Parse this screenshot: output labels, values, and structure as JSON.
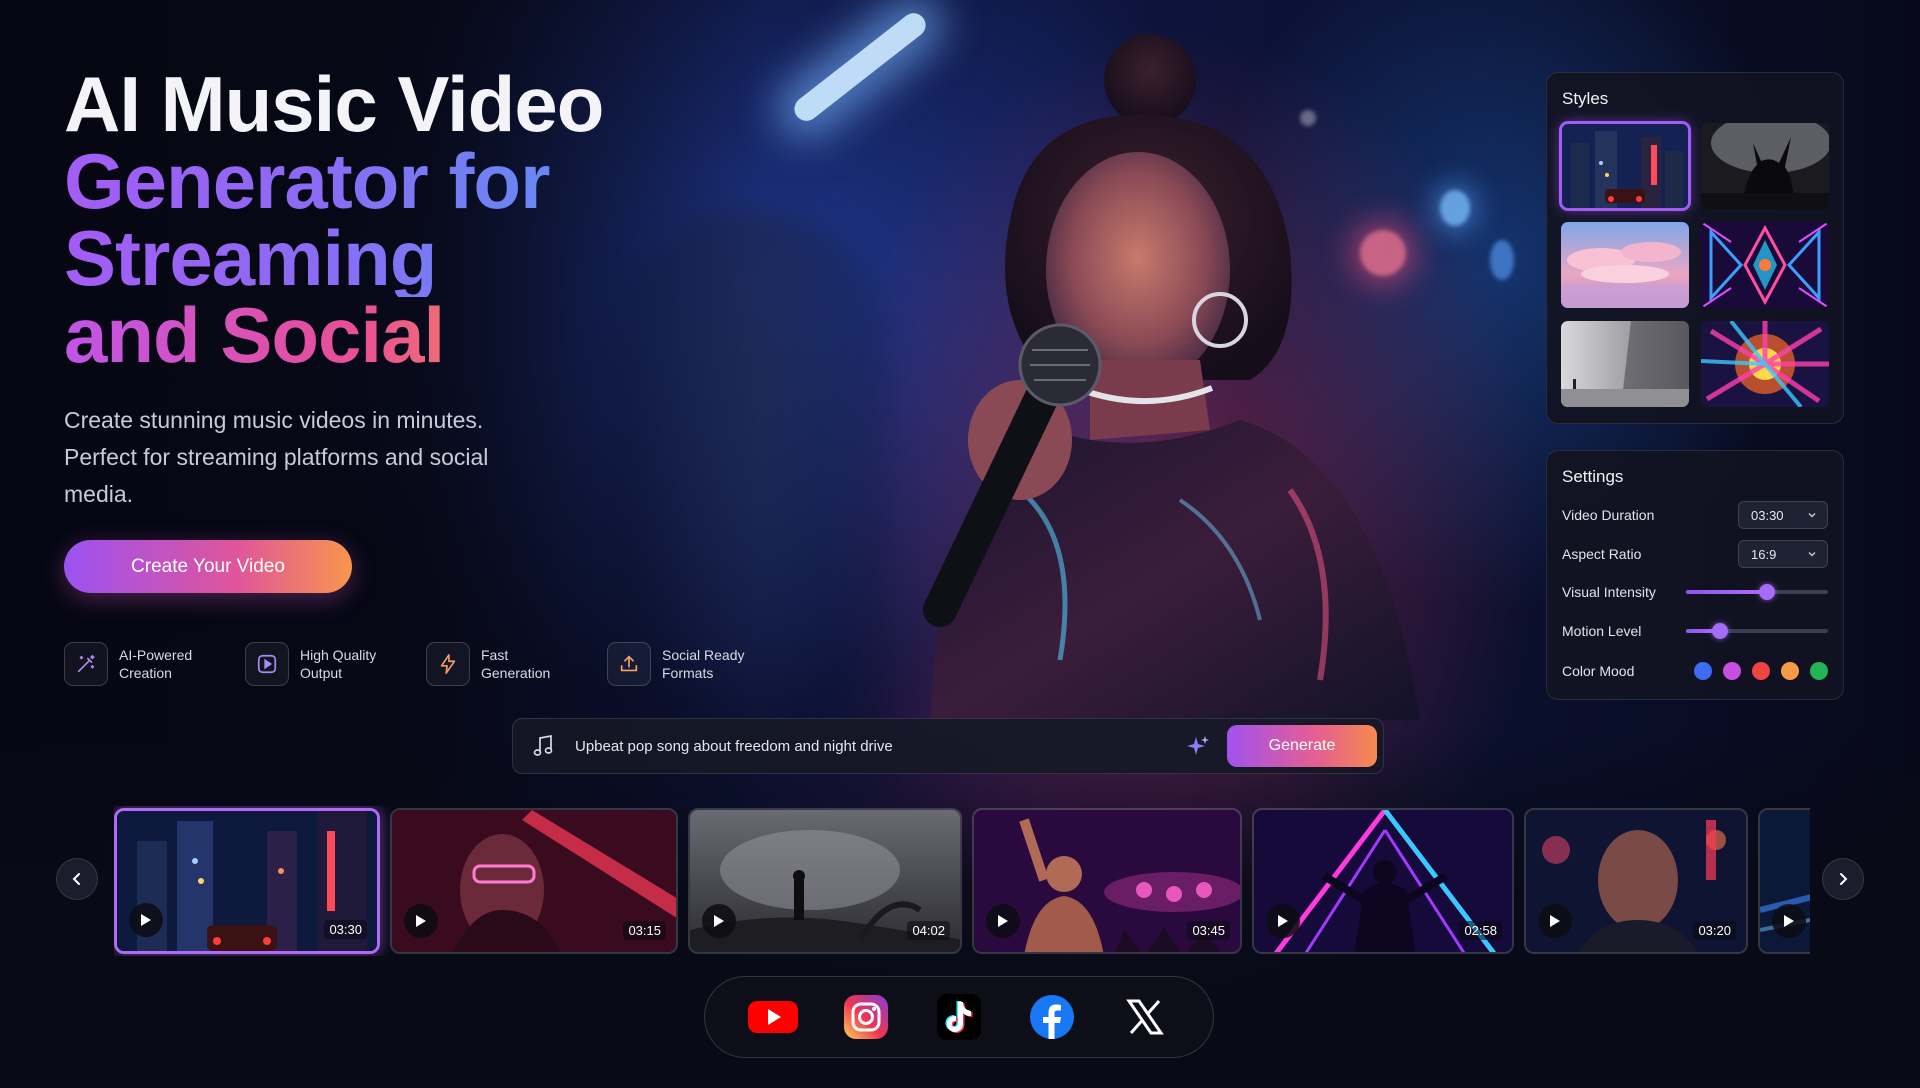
{
  "hero": {
    "title_line1": "AI Music Video",
    "title_line2": "Generator for",
    "title_line3": "Streaming",
    "title_line4": "and Social",
    "subtitle": "Create stunning music videos in minutes. Perfect for streaming platforms and social media.",
    "cta_label": "Create Your Video"
  },
  "features": [
    {
      "icon": "magic-wand-icon",
      "label": "AI-Powered\nCreation"
    },
    {
      "icon": "play-square-icon",
      "label": "High Quality\nOutput"
    },
    {
      "icon": "lightning-icon",
      "label": "Fast\nGeneration"
    },
    {
      "icon": "upload-icon",
      "label": "Social Ready\nFormats"
    }
  ],
  "styles_panel": {
    "title": "Styles",
    "items": [
      {
        "name": "city-night",
        "selected": true
      },
      {
        "name": "monochrome-concert",
        "selected": false
      },
      {
        "name": "pastel-clouds",
        "selected": false
      },
      {
        "name": "kaleidoscope",
        "selected": false
      },
      {
        "name": "minimal-gray",
        "selected": false
      },
      {
        "name": "color-explosion",
        "selected": false
      }
    ]
  },
  "settings": {
    "title": "Settings",
    "video_duration_label": "Video Duration",
    "video_duration_value": "03:30",
    "aspect_ratio_label": "Aspect Ratio",
    "aspect_ratio_value": "16:9",
    "visual_intensity_label": "Visual Intensity",
    "visual_intensity_value": 0.57,
    "motion_level_label": "Motion Level",
    "motion_level_value": 0.24,
    "color_mood_label": "Color Mood",
    "color_mood_swatches": [
      "#3d6cf2",
      "#c64fe0",
      "#ef4444",
      "#f59b45",
      "#22b455"
    ]
  },
  "prompt": {
    "value": "Upbeat pop song about freedom and night drive",
    "generate_label": "Generate"
  },
  "clips": [
    {
      "duration": "03:30",
      "selected": true
    },
    {
      "duration": "03:15",
      "selected": false
    },
    {
      "duration": "04:02",
      "selected": false
    },
    {
      "duration": "03:45",
      "selected": false
    },
    {
      "duration": "02:58",
      "selected": false
    },
    {
      "duration": "03:20",
      "selected": false
    },
    {
      "duration": "",
      "selected": false
    }
  ],
  "social": [
    "youtube-icon",
    "instagram-icon",
    "tiktok-icon",
    "facebook-icon",
    "x-icon"
  ],
  "colors": {
    "accent_purple": "#a35cf7",
    "accent_pink": "#e0559a",
    "accent_orange": "#f7964c"
  }
}
